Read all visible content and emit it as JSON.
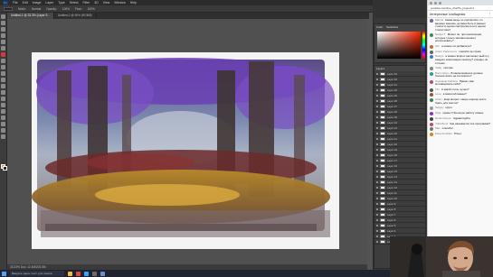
{
  "photoshop": {
    "logo": "Ps",
    "menu": [
      "File",
      "Edit",
      "Image",
      "Layer",
      "Type",
      "Select",
      "Filter",
      "3D",
      "View",
      "Window",
      "Help"
    ],
    "options": {
      "mode_label": "Mode:",
      "mode_value": "Normal",
      "opacity_label": "Opacity:",
      "opacity_value": "100%",
      "flow_label": "Flow:",
      "flow_value": "100%"
    },
    "tabs": [
      "Untitled-1 @ 33.3% (Layer 9...",
      "Untitled-2 @ 50% (RGB/8)"
    ],
    "status": "33.33%    Doc: 12.4M/203.5M",
    "color_panel_tabs": [
      "Color",
      "Swatches"
    ],
    "layers_title": "Layers",
    "layers": [
      "Layer 33",
      "Layer 32",
      "Layer 31",
      "Layer 30",
      "Layer 29",
      "Layer 28",
      "Layer 27",
      "Layer 26",
      "Layer 25",
      "Layer 24",
      "Layer 23",
      "Layer 22",
      "Layer 21",
      "Layer 20",
      "Layer 19",
      "Layer 18",
      "Layer 17",
      "Layer 16",
      "Layer 15",
      "Layer 14",
      "Layer 13",
      "Layer 12",
      "Layer 11",
      "Layer 10",
      "Layer 9",
      "Layer 8",
      "Layer 7",
      "Layer 6",
      "Layer 5",
      "Layer 4",
      "Layer 3",
      "Layer 2"
    ]
  },
  "browser": {
    "address": "youtube.com/live_chat?is_popout=1",
    "chat_title": "Интересные сообщения",
    "messages": [
      {
        "author": "Marina",
        "text": "Какая вещь по портфолио, по вашему мнению, должна быть в разных стилях в одном портфолио или в одном стилистике?",
        "color": "#7b5ea7"
      },
      {
        "author": "Nadya T.",
        "text": "Может ли, при композиции, которые только заливки меняют, использовать?",
        "color": "#3b8a56"
      },
      {
        "author": "Kim",
        "text": "а можно ли добавлять?",
        "color": "#c46b2e"
      },
      {
        "author": "Artem Paramonov",
        "text": "спасибо за стрим",
        "color": "#666"
      },
      {
        "author": "Nastya",
        "text": "а можно вопрос как может выйти у каждого композиции палитру? и видно ли оттенки",
        "color": "#3a7bd5"
      },
      {
        "author": "Vitaly",
        "text": "смотрю",
        "color": "#888"
      },
      {
        "author": "Boris Qwen",
        "text": "В каком моменте должен больше всего на это влиять?",
        "color": "#2d9c8f"
      },
      {
        "author": "Anastasia Kalinina",
        "text": "Привет. Как мотивировать себя?",
        "color": "#b84c6e"
      },
      {
        "author": "Tim",
        "text": "А какой стиль лучше?",
        "color": "#555"
      },
      {
        "author": "Lena",
        "text": "а масштаб важен?",
        "color": "#a0522d"
      },
      {
        "author": "Artem",
        "text": "Ещё вопрос: какую ширину кисти брать для скетча?",
        "color": "#2e8b57"
      },
      {
        "author": "Sergey",
        "text": "круто",
        "color": "#999"
      },
      {
        "author": "Olga",
        "text": "привет! Прошлую работу помню",
        "color": "#8a2be2"
      },
      {
        "author": "Denis Karpov",
        "text": "Здравствуйте",
        "color": "#444"
      },
      {
        "author": "Yulia Bond",
        "text": "Как называется эта программа?",
        "color": "#cc4477"
      },
      {
        "author": "Max",
        "text": "спасибо!",
        "color": "#777"
      },
      {
        "author": "Pavel Koshkin",
        "text": "Privet",
        "color": "#d68a00"
      }
    ]
  },
  "taskbar": {
    "search_placeholder": "Введите здесь текст для поиска"
  }
}
